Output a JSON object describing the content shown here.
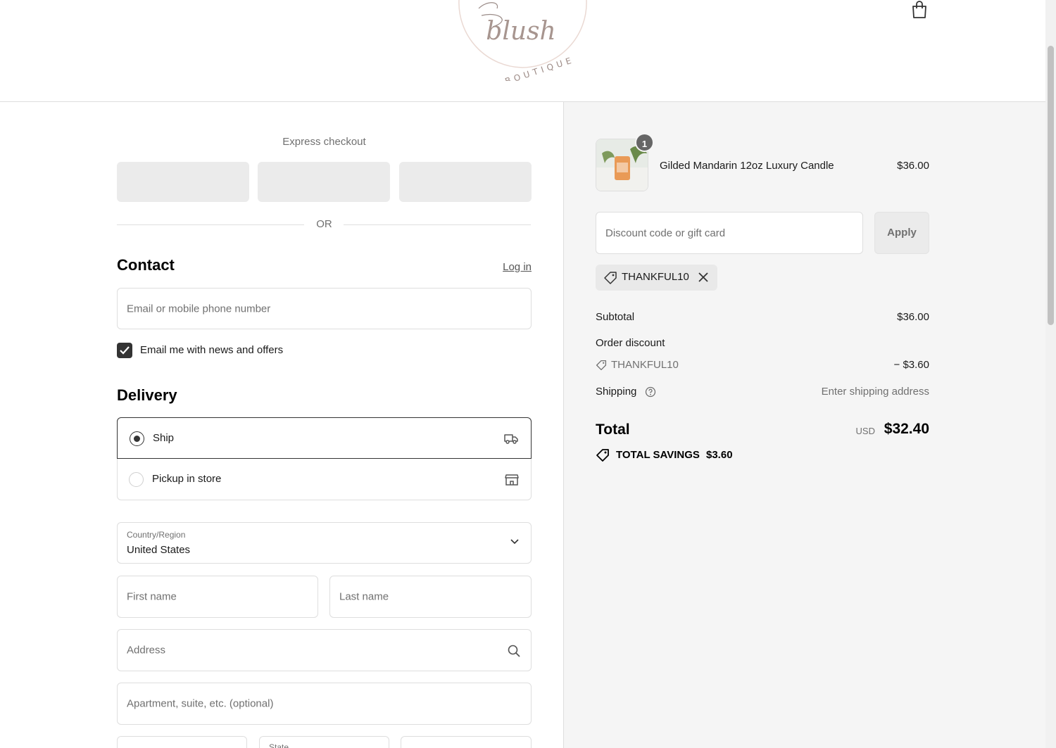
{
  "header": {
    "logo_script": "blush",
    "logo_sub": "BOUTIQUE"
  },
  "express": {
    "label": "Express checkout",
    "or_label": "OR"
  },
  "contact": {
    "title": "Contact",
    "login_label": "Log in",
    "email_placeholder": "Email or mobile phone number",
    "newsletter_label": "Email me with news and offers",
    "newsletter_checked": true
  },
  "delivery": {
    "title": "Delivery",
    "options": [
      {
        "label": "Ship",
        "selected": true,
        "icon": "truck-icon"
      },
      {
        "label": "Pickup in store",
        "selected": false,
        "icon": "store-icon"
      }
    ],
    "country_label": "Country/Region",
    "country_value": "United States",
    "first_name_placeholder": "First name",
    "last_name_placeholder": "Last name",
    "address_placeholder": "Address",
    "apartment_placeholder": "Apartment, suite, etc. (optional)",
    "state_placeholder": "State"
  },
  "summary": {
    "item": {
      "name": "Gilded Mandarin 12oz Luxury Candle",
      "price": "$36.00",
      "quantity": "1"
    },
    "discount_placeholder": "Discount code or gift card",
    "apply_label": "Apply",
    "applied_code": "THANKFUL10",
    "subtotal_label": "Subtotal",
    "subtotal_value": "$36.00",
    "order_discount_label": "Order discount",
    "discount_code": "THANKFUL10",
    "discount_value": "− $3.60",
    "shipping_label": "Shipping",
    "shipping_value": "Enter shipping address",
    "total_label": "Total",
    "total_currency": "USD",
    "total_value": "$32.40",
    "savings_label": "TOTAL SAVINGS",
    "savings_value": "$3.60"
  },
  "colors": {
    "accent": "#333333",
    "summary_bg": "#f5f5f5",
    "logo_tint": "#c9a49a"
  }
}
